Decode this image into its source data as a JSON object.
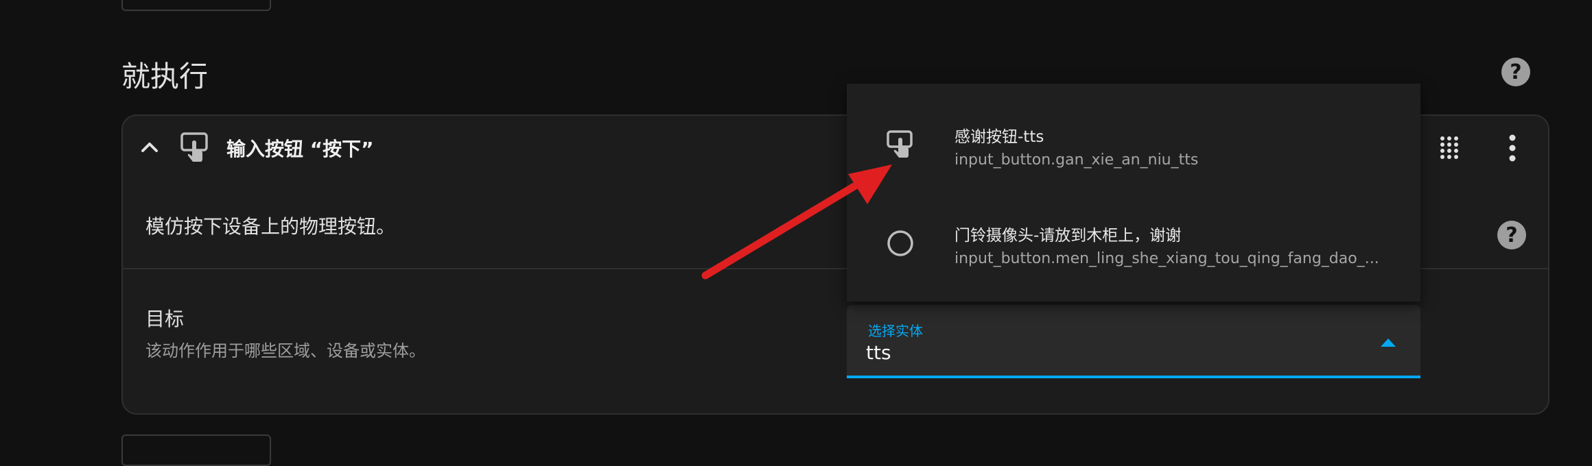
{
  "section": {
    "title": "就执行"
  },
  "action": {
    "title": "输入按钮 “按下”",
    "description": "模仿按下设备上的物理按钮。",
    "target_label": "目标",
    "target_description": "该动作作用于哪些区域、设备或实体。"
  },
  "entity_field": {
    "label": "选择实体",
    "value": "tts"
  },
  "dropdown": {
    "options": [
      {
        "name": "感谢按钮-tts",
        "entity_id": "input_button.gan_xie_an_niu_tts",
        "icon": "gesture-tap-button-icon"
      },
      {
        "name": "门铃摄像头-请放到木柜上，谢谢",
        "entity_id": "input_button.men_ling_she_xiang_tou_qing_fang_dao_...",
        "icon": "empty-circle-icon"
      }
    ]
  },
  "icons": {
    "help": "?",
    "collapse": "chevron-up-icon",
    "action": "gesture-tap-button-icon",
    "drag": "drag-handle-icon",
    "more": "dots-vertical-icon"
  },
  "colors": {
    "background": "#111111",
    "card": "#1c1c1c",
    "accent": "#03a9f4",
    "annotation": "#e02020"
  }
}
